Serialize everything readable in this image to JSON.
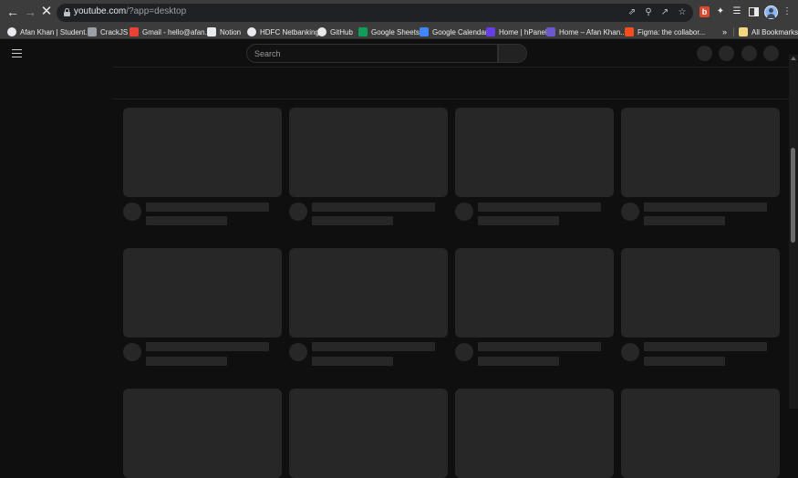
{
  "browser": {
    "url_host": "youtube.com",
    "url_path": "/?app=desktop",
    "bookmarks": [
      {
        "label": "Afan Khan | Student...",
        "color": "#e8eaed",
        "round": true
      },
      {
        "label": "CrackJS",
        "color": "#9aa0a6",
        "round": false
      },
      {
        "label": "Gmail - hello@afan...",
        "color": "#ea4335",
        "round": false
      },
      {
        "label": "Notion",
        "color": "#e8eaed",
        "round": false
      },
      {
        "label": "HDFC Netbanking",
        "color": "#e8eaed",
        "round": true
      },
      {
        "label": "GitHub",
        "color": "#e8eaed",
        "round": true
      },
      {
        "label": "Google Sheets",
        "color": "#0f9d58",
        "round": false
      },
      {
        "label": "Google Calendar",
        "color": "#4285f4",
        "round": false
      },
      {
        "label": "Home | hPanel",
        "color": "#673de6",
        "round": false
      },
      {
        "label": "Home – Afan Khan...",
        "color": "#6a5acd",
        "round": false
      },
      {
        "label": "Figma: the collabor...",
        "color": "#f24e1e",
        "round": false
      }
    ],
    "more_bookmarks_glyph": "»",
    "all_bookmarks_label": "All Bookmarks",
    "extension_badge": "b"
  },
  "youtube": {
    "search_placeholder": "Search"
  }
}
